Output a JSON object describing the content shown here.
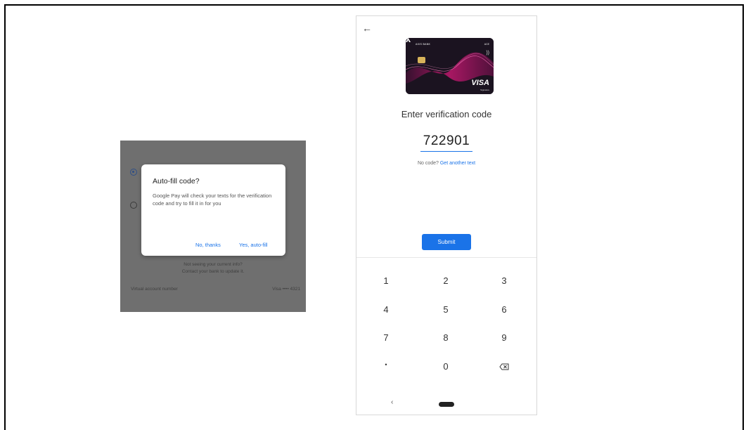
{
  "dialog_screen": {
    "dialog": {
      "title": "Auto-fill code?",
      "body": "Google Pay will check your texts for the verification code and try to fill it in for you",
      "no_label": "No, thanks",
      "yes_label": "Yes, auto-fill"
    },
    "info_line1": "Not seeing your current info?",
    "info_line2": "Contact your bank to update it.",
    "virtual_label": "Virtual account number",
    "virtual_value": "Visa •••• 4321"
  },
  "verification_screen": {
    "card": {
      "bank_name": "AXIS BANK",
      "tag": "ACE",
      "brand": "VISA",
      "brand_sub": "Signature"
    },
    "title": "Enter verification code",
    "code": "722901",
    "no_code_text": "No code?",
    "get_another_text": "Get another text",
    "submit_label": "Submit",
    "keypad": {
      "k1": "1",
      "k2": "2",
      "k3": "3",
      "k4": "4",
      "k5": "5",
      "k6": "6",
      "k7": "7",
      "k8": "8",
      "k9": "9",
      "dot": "•",
      "k0": "0"
    },
    "icons": {
      "back": "arrow-left-icon",
      "backspace": "backspace-icon",
      "nav_back": "chevron-left-icon",
      "nav_home": "home-pill-icon"
    }
  }
}
